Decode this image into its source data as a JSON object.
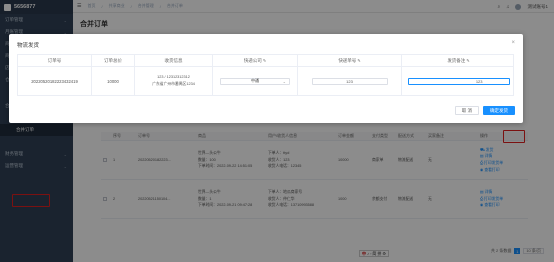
{
  "app": {
    "logo_text": "5656877"
  },
  "sidebar": {
    "items": [
      {
        "label": "订单管理"
      },
      {
        "label": "月账管理"
      },
      {
        "label": "商品管理"
      },
      {
        "label": "商家管理"
      },
      {
        "label": "店铺管理"
      },
      {
        "label": "仓库管理"
      }
    ],
    "group_label": "合并管理",
    "sub_items": [
      {
        "label": "合并列表"
      },
      {
        "label": "合并订单"
      }
    ],
    "bottom_items": [
      {
        "label": "财务管理"
      },
      {
        "label": "运营管理"
      }
    ]
  },
  "navbar": {
    "breadcrumb": [
      "首页",
      "共享商业",
      "合并管理",
      "合并订单"
    ],
    "user_label": "测试账号1"
  },
  "page": {
    "title": "合并订单"
  },
  "bg_table": {
    "headers": [
      "",
      "序号",
      "订单号",
      "商品",
      "用户/收货人信息",
      "订单金额",
      "支付类型",
      "配送方式",
      "买家备注",
      "操作"
    ],
    "rows": [
      {
        "index": "1",
        "order_no": "20220520182223...",
        "goods": [
          "世界—头公牛",
          "数量：100",
          "下单时间：2022-09-22 14:51:05"
        ],
        "user": [
          "下单人：ttyd",
          "收货人：123",
          "收货人电话：12345"
        ],
        "amount": "10000",
        "pay": "商家单",
        "delivery": "物流配送",
        "remark": "无",
        "ops": [
          "发货",
          "详情",
          "打印发货单",
          "查看打印"
        ]
      },
      {
        "index": "2",
        "order_no": "20220521150104...",
        "goods": [
          "世界—头公牛",
          "数量：1",
          "下单时间：2022-09-21 09:47:28"
        ],
        "user": [
          "下单人：地瓜商家号",
          "收货人：仲仁华",
          "收货人电话：13710993588"
        ],
        "amount": "1000",
        "pay": "余额支付",
        "delivery": "物流配送",
        "remark": "无",
        "ops": [
          "详情",
          "打印发货单",
          "查看打印"
        ]
      }
    ]
  },
  "pagination": {
    "total": "共 2 条数据",
    "page": "1",
    "size": "10 条/页"
  },
  "ime": [
    "中",
    "♪",
    "◦",
    "简",
    "拼",
    "⚙"
  ],
  "dialog": {
    "title": "物流发货",
    "close": "×",
    "headers": [
      "订单号",
      "订单总价",
      "收货信息",
      "快递公司",
      "快递单号",
      "发货备注",
      "操作"
    ],
    "row": {
      "order_no": "20220520182223432419",
      "total": "10000",
      "address_phone": "123 / 12312312312",
      "address_line": "广东省广州市番禺区1234",
      "courier": "中通",
      "tracking_no": "123",
      "remark": "123"
    },
    "cancel_label": "取 消",
    "ok_label": "确定发货"
  }
}
